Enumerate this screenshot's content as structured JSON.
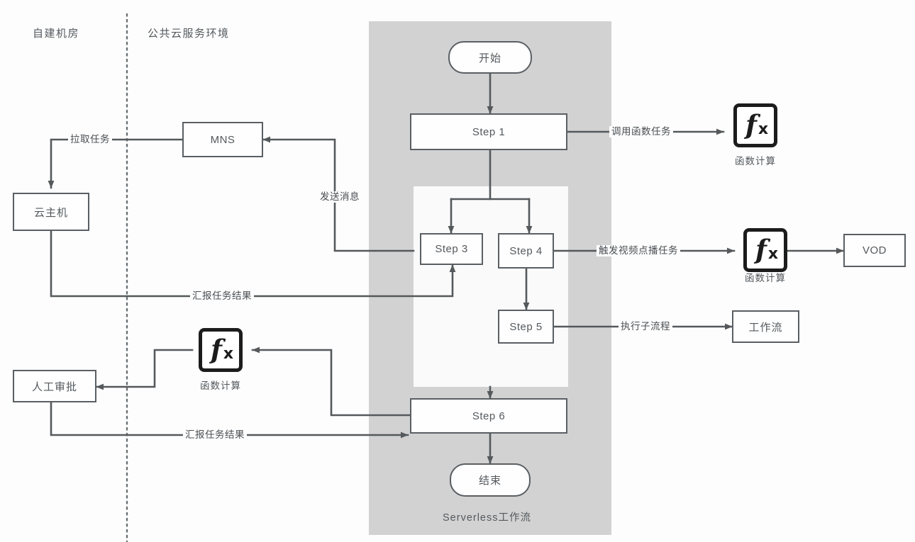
{
  "diagram": {
    "title_caption": "Serverless工作流",
    "regions": [
      {
        "id": "onprem",
        "label": "自建机房"
      },
      {
        "id": "cloud",
        "label": "公共云服务环境"
      }
    ],
    "colors": {
      "band": "#d2d2d2",
      "inner_panel": "#fafafa",
      "node_border": "#5a5f63",
      "node_text": "#54595d",
      "icon_border": "#1c1c1c",
      "line": "#55595c",
      "divider": "#6b7073",
      "page_bg": "#fdfdfd"
    },
    "nodes": [
      {
        "id": "mns",
        "label": "MNS"
      },
      {
        "id": "cloudhost",
        "label": "云主机"
      },
      {
        "id": "approval",
        "label": "人工审批"
      },
      {
        "id": "start",
        "label": "开始"
      },
      {
        "id": "step1",
        "label": "Step 1"
      },
      {
        "id": "step3",
        "label": "Step 3"
      },
      {
        "id": "step4",
        "label": "Step 4"
      },
      {
        "id": "step5",
        "label": "Step 5"
      },
      {
        "id": "step6",
        "label": "Step 6"
      },
      {
        "id": "end",
        "label": "结束"
      },
      {
        "id": "vod",
        "label": "VOD"
      },
      {
        "id": "workflow",
        "label": "工作流"
      }
    ],
    "icons": [
      {
        "id": "fc_top",
        "name": "function-compute-icon",
        "glyph": "fx",
        "caption": "函数计算"
      },
      {
        "id": "fc_mid",
        "name": "function-compute-icon",
        "glyph": "fx",
        "caption": "函数计算"
      },
      {
        "id": "fc_bottom",
        "name": "function-compute-icon",
        "glyph": "fx",
        "caption": "函数计算"
      }
    ],
    "edge_labels": [
      {
        "id": "pull_task",
        "text": "拉取任务"
      },
      {
        "id": "send_msg",
        "text": "发送消息"
      },
      {
        "id": "report_mid",
        "text": "汇报任务结果"
      },
      {
        "id": "report_bottom",
        "text": "汇报任务结果"
      },
      {
        "id": "invoke_fn",
        "text": "调用函数任务"
      },
      {
        "id": "trigger_vod",
        "text": "触发视频点播任务"
      },
      {
        "id": "exec_sub",
        "text": "执行子流程"
      }
    ]
  }
}
